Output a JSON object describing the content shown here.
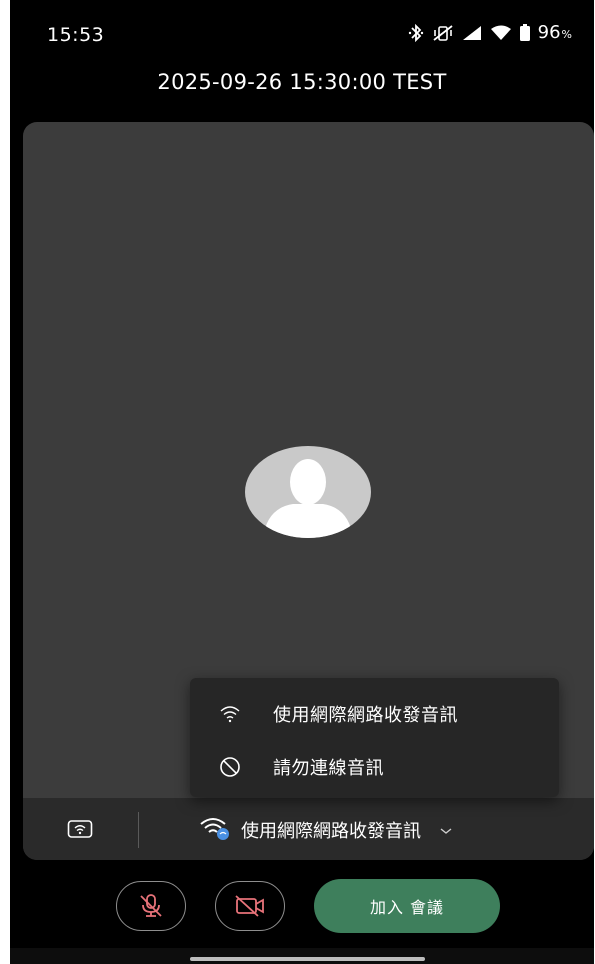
{
  "status_bar": {
    "time": "15:53",
    "battery_percent": "96",
    "battery_unit": "%",
    "icons": [
      "bluetooth-icon",
      "vibrate-off-icon",
      "signal-icon",
      "wifi-icon",
      "battery-icon"
    ]
  },
  "meeting": {
    "title": "2025-09-26 15:30:00 TEST"
  },
  "audio_menu": {
    "items": [
      {
        "label": "使用網際網路收發音訊",
        "icon": "wifi-icon"
      },
      {
        "label": "請勿連線音訊",
        "icon": "block-icon"
      }
    ]
  },
  "audio_bar": {
    "selected_label": "使用網際網路收發音訊",
    "selected_icon": "wifi-bluetooth-icon"
  },
  "controls": {
    "join_label": "加入 會議",
    "mic_state": "muted",
    "camera_state": "off"
  },
  "colors": {
    "preview_bg": "#3c3c3c",
    "join_button": "#3e7f5c",
    "muted_icon": "#e8737a",
    "accent_blue": "#4a90e2"
  }
}
